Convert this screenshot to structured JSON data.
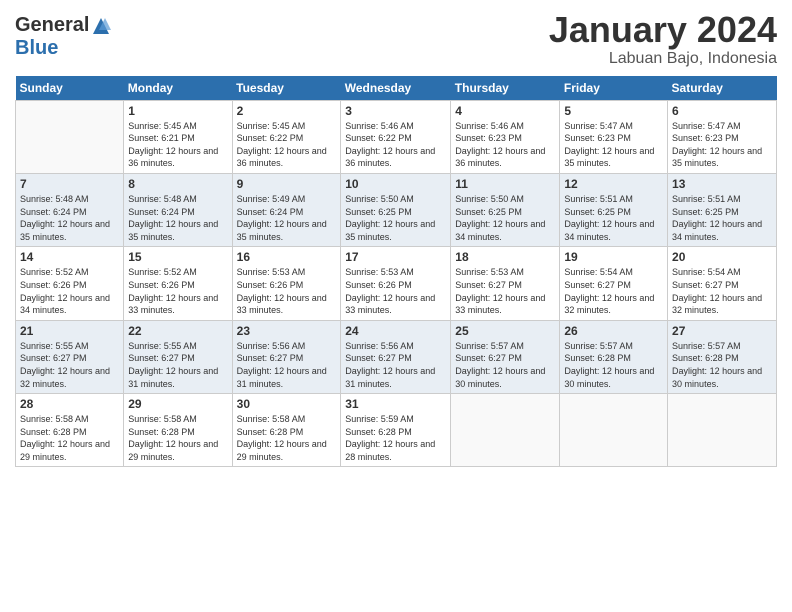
{
  "header": {
    "logo_general": "General",
    "logo_blue": "Blue",
    "month_title": "January 2024",
    "location": "Labuan Bajo, Indonesia"
  },
  "days_of_week": [
    "Sunday",
    "Monday",
    "Tuesday",
    "Wednesday",
    "Thursday",
    "Friday",
    "Saturday"
  ],
  "weeks": [
    [
      {
        "day": "",
        "sunrise": "",
        "sunset": "",
        "daylight": ""
      },
      {
        "day": "1",
        "sunrise": "5:45 AM",
        "sunset": "6:21 PM",
        "daylight": "12 hours and 36 minutes."
      },
      {
        "day": "2",
        "sunrise": "5:45 AM",
        "sunset": "6:22 PM",
        "daylight": "12 hours and 36 minutes."
      },
      {
        "day": "3",
        "sunrise": "5:46 AM",
        "sunset": "6:22 PM",
        "daylight": "12 hours and 36 minutes."
      },
      {
        "day": "4",
        "sunrise": "5:46 AM",
        "sunset": "6:23 PM",
        "daylight": "12 hours and 36 minutes."
      },
      {
        "day": "5",
        "sunrise": "5:47 AM",
        "sunset": "6:23 PM",
        "daylight": "12 hours and 35 minutes."
      },
      {
        "day": "6",
        "sunrise": "5:47 AM",
        "sunset": "6:23 PM",
        "daylight": "12 hours and 35 minutes."
      }
    ],
    [
      {
        "day": "7",
        "sunrise": "5:48 AM",
        "sunset": "6:24 PM",
        "daylight": "12 hours and 35 minutes."
      },
      {
        "day": "8",
        "sunrise": "5:48 AM",
        "sunset": "6:24 PM",
        "daylight": "12 hours and 35 minutes."
      },
      {
        "day": "9",
        "sunrise": "5:49 AM",
        "sunset": "6:24 PM",
        "daylight": "12 hours and 35 minutes."
      },
      {
        "day": "10",
        "sunrise": "5:50 AM",
        "sunset": "6:25 PM",
        "daylight": "12 hours and 35 minutes."
      },
      {
        "day": "11",
        "sunrise": "5:50 AM",
        "sunset": "6:25 PM",
        "daylight": "12 hours and 34 minutes."
      },
      {
        "day": "12",
        "sunrise": "5:51 AM",
        "sunset": "6:25 PM",
        "daylight": "12 hours and 34 minutes."
      },
      {
        "day": "13",
        "sunrise": "5:51 AM",
        "sunset": "6:25 PM",
        "daylight": "12 hours and 34 minutes."
      }
    ],
    [
      {
        "day": "14",
        "sunrise": "5:52 AM",
        "sunset": "6:26 PM",
        "daylight": "12 hours and 34 minutes."
      },
      {
        "day": "15",
        "sunrise": "5:52 AM",
        "sunset": "6:26 PM",
        "daylight": "12 hours and 33 minutes."
      },
      {
        "day": "16",
        "sunrise": "5:53 AM",
        "sunset": "6:26 PM",
        "daylight": "12 hours and 33 minutes."
      },
      {
        "day": "17",
        "sunrise": "5:53 AM",
        "sunset": "6:26 PM",
        "daylight": "12 hours and 33 minutes."
      },
      {
        "day": "18",
        "sunrise": "5:53 AM",
        "sunset": "6:27 PM",
        "daylight": "12 hours and 33 minutes."
      },
      {
        "day": "19",
        "sunrise": "5:54 AM",
        "sunset": "6:27 PM",
        "daylight": "12 hours and 32 minutes."
      },
      {
        "day": "20",
        "sunrise": "5:54 AM",
        "sunset": "6:27 PM",
        "daylight": "12 hours and 32 minutes."
      }
    ],
    [
      {
        "day": "21",
        "sunrise": "5:55 AM",
        "sunset": "6:27 PM",
        "daylight": "12 hours and 32 minutes."
      },
      {
        "day": "22",
        "sunrise": "5:55 AM",
        "sunset": "6:27 PM",
        "daylight": "12 hours and 31 minutes."
      },
      {
        "day": "23",
        "sunrise": "5:56 AM",
        "sunset": "6:27 PM",
        "daylight": "12 hours and 31 minutes."
      },
      {
        "day": "24",
        "sunrise": "5:56 AM",
        "sunset": "6:27 PM",
        "daylight": "12 hours and 31 minutes."
      },
      {
        "day": "25",
        "sunrise": "5:57 AM",
        "sunset": "6:27 PM",
        "daylight": "12 hours and 30 minutes."
      },
      {
        "day": "26",
        "sunrise": "5:57 AM",
        "sunset": "6:28 PM",
        "daylight": "12 hours and 30 minutes."
      },
      {
        "day": "27",
        "sunrise": "5:57 AM",
        "sunset": "6:28 PM",
        "daylight": "12 hours and 30 minutes."
      }
    ],
    [
      {
        "day": "28",
        "sunrise": "5:58 AM",
        "sunset": "6:28 PM",
        "daylight": "12 hours and 29 minutes."
      },
      {
        "day": "29",
        "sunrise": "5:58 AM",
        "sunset": "6:28 PM",
        "daylight": "12 hours and 29 minutes."
      },
      {
        "day": "30",
        "sunrise": "5:58 AM",
        "sunset": "6:28 PM",
        "daylight": "12 hours and 29 minutes."
      },
      {
        "day": "31",
        "sunrise": "5:59 AM",
        "sunset": "6:28 PM",
        "daylight": "12 hours and 28 minutes."
      },
      {
        "day": "",
        "sunrise": "",
        "sunset": "",
        "daylight": ""
      },
      {
        "day": "",
        "sunrise": "",
        "sunset": "",
        "daylight": ""
      },
      {
        "day": "",
        "sunrise": "",
        "sunset": "",
        "daylight": ""
      }
    ]
  ]
}
